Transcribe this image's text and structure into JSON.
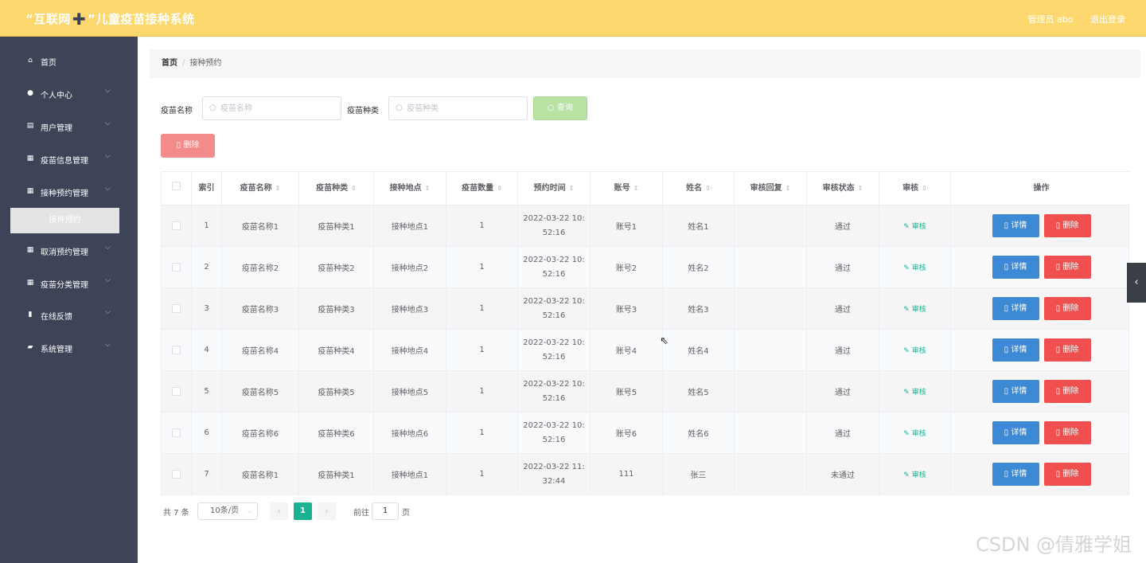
{
  "header": {
    "title_quote_open": "“互联网",
    "title_plus": "✚",
    "title_rest": "”儿童疫苗接种系统",
    "user_label": "管理员 abo",
    "logout": "退出登录"
  },
  "sidebar": {
    "items": [
      {
        "label": "首页",
        "icon": "home-icon",
        "glyph": "⌂",
        "has_arrow": false
      },
      {
        "label": "个人中心",
        "icon": "user-icon",
        "glyph": "●",
        "has_arrow": true
      },
      {
        "label": "用户管理",
        "icon": "clipboard-icon",
        "glyph": "▤",
        "has_arrow": true
      },
      {
        "label": "疫苗信息管理",
        "icon": "grid-icon",
        "glyph": "▦",
        "has_arrow": true
      },
      {
        "label": "接种预约管理",
        "icon": "grid-icon",
        "glyph": "▦",
        "has_arrow": true
      },
      {
        "label": "取消预约管理",
        "icon": "grid-icon",
        "glyph": "▦",
        "has_arrow": true
      },
      {
        "label": "疫苗分类管理",
        "icon": "apps-icon",
        "glyph": "▦",
        "has_arrow": true
      },
      {
        "label": "在线反馈",
        "icon": "bar-chart-icon",
        "glyph": "▮",
        "has_arrow": true
      },
      {
        "label": "系统管理",
        "icon": "folder-icon",
        "glyph": "▰",
        "has_arrow": true
      }
    ],
    "active_sub": "接种预约"
  },
  "breadcrumb": {
    "home": "首页",
    "separator": "/",
    "current": "接种预约"
  },
  "search": {
    "name_label": "疫苗名称",
    "name_placeholder": "疫苗名称",
    "type_label": "疫苗种类",
    "type_placeholder": "疫苗种类",
    "query_button": "查询",
    "bulk_delete": "删除"
  },
  "table": {
    "columns": [
      "索引",
      "疫苗名称",
      "疫苗种类",
      "接种地点",
      "疫苗数量",
      "预约时间",
      "账号",
      "姓名",
      "审核回复",
      "审核状态",
      "审核",
      "操作"
    ],
    "sortable": [
      false,
      true,
      true,
      true,
      true,
      true,
      true,
      true,
      true,
      true,
      true,
      false
    ],
    "rows": [
      {
        "index": "1",
        "vaccine_name": "疫苗名称1",
        "vaccine_type": "疫苗种类1",
        "location": "接种地点1",
        "quantity": "1",
        "time": "2022-03-22 10:52:16",
        "account": "账号1",
        "name": "姓名1",
        "reply": "",
        "status": "通过"
      },
      {
        "index": "2",
        "vaccine_name": "疫苗名称2",
        "vaccine_type": "疫苗种类2",
        "location": "接种地点2",
        "quantity": "1",
        "time": "2022-03-22 10:52:16",
        "account": "账号2",
        "name": "姓名2",
        "reply": "",
        "status": "通过"
      },
      {
        "index": "3",
        "vaccine_name": "疫苗名称3",
        "vaccine_type": "疫苗种类3",
        "location": "接种地点3",
        "quantity": "1",
        "time": "2022-03-22 10:52:16",
        "account": "账号3",
        "name": "姓名3",
        "reply": "",
        "status": "通过"
      },
      {
        "index": "4",
        "vaccine_name": "疫苗名称4",
        "vaccine_type": "疫苗种类4",
        "location": "接种地点4",
        "quantity": "1",
        "time": "2022-03-22 10:52:16",
        "account": "账号4",
        "name": "姓名4",
        "reply": "",
        "status": "通过"
      },
      {
        "index": "5",
        "vaccine_name": "疫苗名称5",
        "vaccine_type": "疫苗种类5",
        "location": "接种地点5",
        "quantity": "1",
        "time": "2022-03-22 10:52:16",
        "account": "账号5",
        "name": "姓名5",
        "reply": "",
        "status": "通过"
      },
      {
        "index": "6",
        "vaccine_name": "疫苗名称6",
        "vaccine_type": "疫苗种类6",
        "location": "接种地点6",
        "quantity": "1",
        "time": "2022-03-22 10:52:16",
        "account": "账号6",
        "name": "姓名6",
        "reply": "",
        "status": "通过"
      },
      {
        "index": "7",
        "vaccine_name": "疫苗名称1",
        "vaccine_type": "疫苗种类1",
        "location": "接种地点1",
        "quantity": "1",
        "time": "2022-03-22 11:32:44",
        "account": "111",
        "name": "张三",
        "reply": "",
        "status": "未通过"
      }
    ],
    "audit_link": "审核",
    "detail_button": "详情",
    "delete_button": "删除"
  },
  "pagination": {
    "total": "共 7 条",
    "page_size": "10条/页",
    "current_page": "1",
    "goto_label": "前往",
    "goto_value": "1",
    "page_unit": "页"
  },
  "watermark": "CSDN @倩雅学姐",
  "colors": {
    "header": "#fcd86f",
    "sidebar": "#3d4458",
    "primary_green": "#19b394",
    "detail_blue": "#3d89d4",
    "delete_red": "#f04f4f"
  }
}
